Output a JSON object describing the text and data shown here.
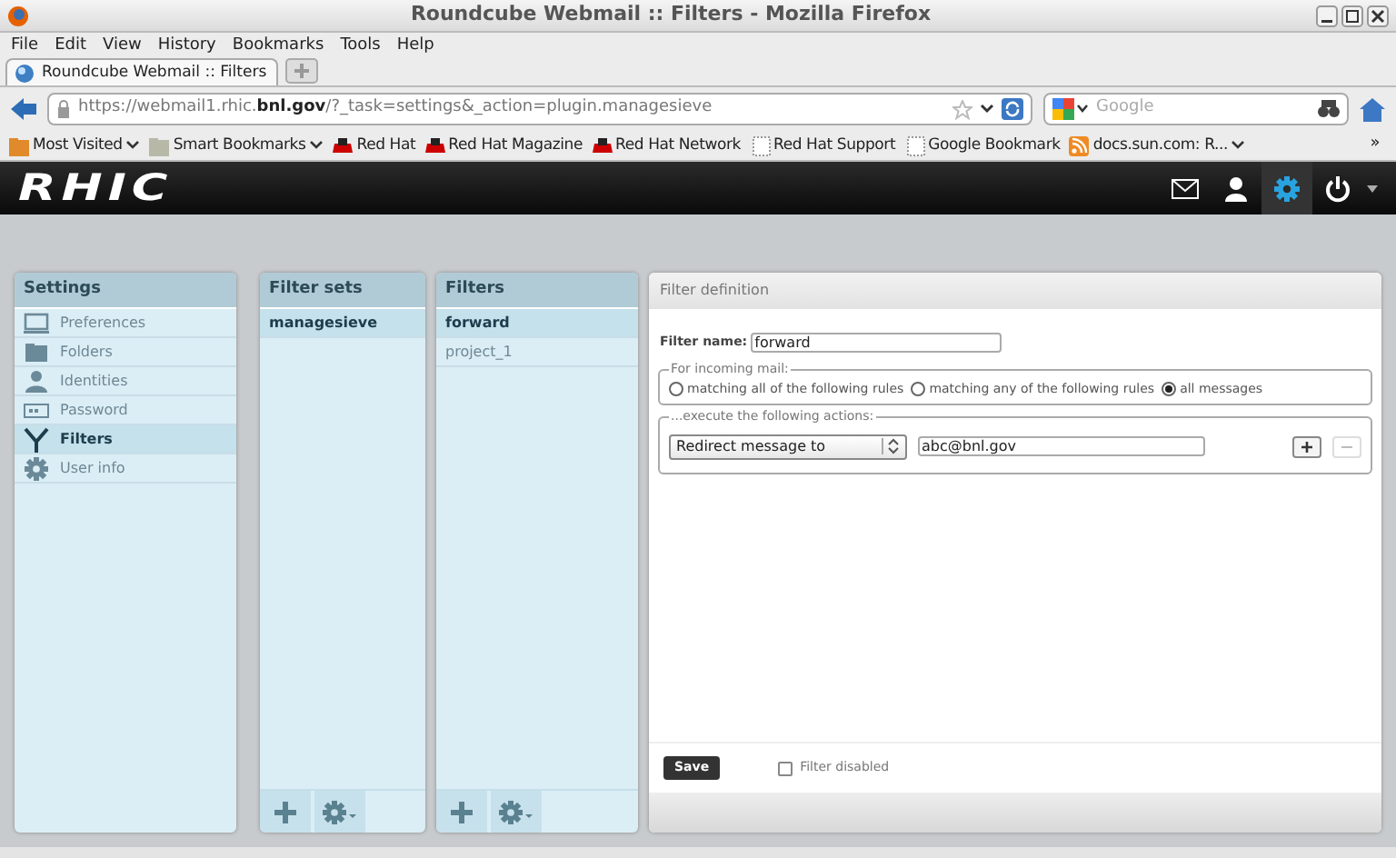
{
  "window": {
    "title": "Roundcube Webmail :: Filters - Mozilla Firefox"
  },
  "menu": [
    "File",
    "Edit",
    "View",
    "History",
    "Bookmarks",
    "Tools",
    "Help"
  ],
  "tabs": [
    {
      "label": "Roundcube Webmail :: Filters",
      "selected": true
    }
  ],
  "url": {
    "prefix": "https://webmail1.rhic.",
    "domain": "bnl.gov",
    "path": "/?_task=settings&_action=plugin.managesieve"
  },
  "search": {
    "placeholder": "Google"
  },
  "bookmarks": [
    {
      "label": "Most Visited",
      "kind": "folder-menu"
    },
    {
      "label": "Smart Bookmarks",
      "kind": "smart-menu"
    },
    {
      "label": "Red Hat",
      "kind": "redhat"
    },
    {
      "label": "Red Hat Magazine",
      "kind": "redhat"
    },
    {
      "label": "Red Hat Network",
      "kind": "redhat"
    },
    {
      "label": "Red Hat Support",
      "kind": "page"
    },
    {
      "label": "Google Bookmark",
      "kind": "page"
    },
    {
      "label": "docs.sun.com: R...",
      "kind": "feed"
    }
  ],
  "bookmarks_overflow": "»",
  "logo": "RHIC",
  "settings": {
    "title": "Settings",
    "items": [
      {
        "label": "Preferences",
        "selected": false
      },
      {
        "label": "Folders",
        "selected": false
      },
      {
        "label": "Identities",
        "selected": false
      },
      {
        "label": "Password",
        "selected": false
      },
      {
        "label": "Filters",
        "selected": true
      },
      {
        "label": "User info",
        "selected": false
      }
    ]
  },
  "filter_sets": {
    "title": "Filter sets",
    "items": [
      {
        "label": "managesieve",
        "selected": true
      }
    ]
  },
  "filters": {
    "title": "Filters",
    "items": [
      {
        "label": "forward",
        "selected": true
      },
      {
        "label": "project_1",
        "selected": false
      }
    ]
  },
  "filter_definition": {
    "title": "Filter definition",
    "name_label": "Filter name:",
    "name_value": "forward",
    "incoming_legend": "For incoming mail:",
    "options": [
      {
        "label": "matching all of the following rules",
        "selected": false
      },
      {
        "label": "matching any of the following rules",
        "selected": false
      },
      {
        "label": "all messages",
        "selected": true
      }
    ],
    "actions_legend": "...execute the following actions:",
    "action": "Redirect message to",
    "target": "abc@bnl.gov",
    "save": "Save",
    "disabled": {
      "label": "Filter disabled",
      "checked": false
    }
  }
}
